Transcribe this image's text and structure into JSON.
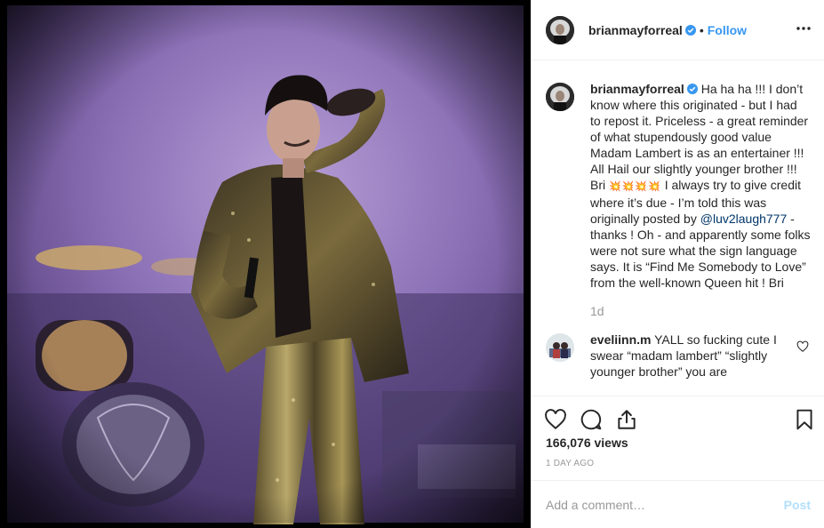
{
  "post": {
    "username": "brianmayforreal",
    "follow_label": "Follow",
    "separator": "•"
  },
  "caption": {
    "username": "brianmayforreal",
    "text_1": "Ha ha ha !!! I don’t know where this originated - but I had to repost it. Priceless - a great reminder of what stupendously good value Madam Lambert is as an entertainer !!! All Hail our slightly younger brother !!! Bri",
    "emoji": "💥💥💥💥",
    "text_2": "I always try to give credit where it’s due - I’m told this was originally posted by",
    "mention": "@luv2laugh777",
    "text_3": "- thanks ! Oh - and apparently some folks were not sure what the sign language says. It is “Find Me Somebody to Love” from the well-known Queen hit ! Bri",
    "age": "1d"
  },
  "comment": {
    "username": "eveliinn.m",
    "text": "YALL so fucking cute I swear “madam lambert” “slightly younger brother” you are"
  },
  "stats": {
    "views": "166,076 views",
    "date": "1 DAY AGO"
  },
  "composer": {
    "placeholder": "Add a comment…",
    "post_label": "Post"
  },
  "icons": {
    "verified": "verified-badge-icon",
    "more": "more-options-icon",
    "like": "heart-icon",
    "comment": "comment-bubble-icon",
    "share": "share-icon",
    "save": "bookmark-icon"
  },
  "colors": {
    "accent": "#3897f0",
    "post_disabled": "#b2dffc",
    "meta": "#999999",
    "mention": "#003569"
  }
}
